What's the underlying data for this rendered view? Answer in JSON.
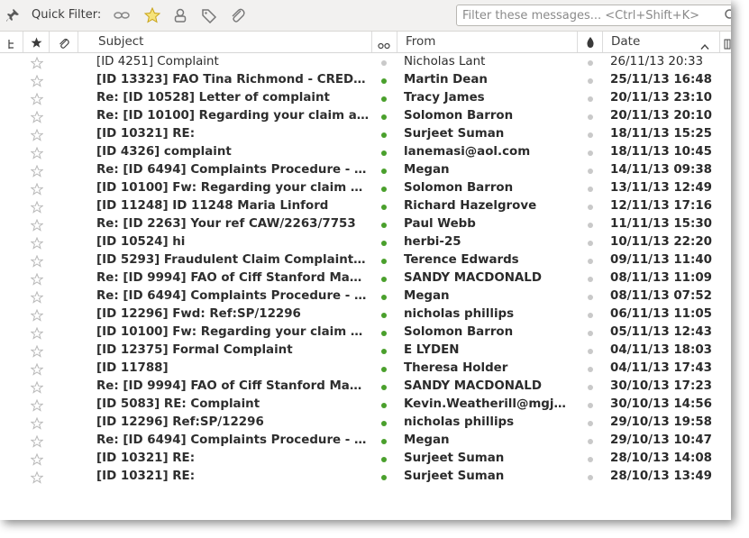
{
  "quick_filter": {
    "label": "Quick Filter:",
    "buttons": [
      "keep-filters-icon",
      "starred-icon",
      "contact-icon",
      "tags-icon",
      "attachment-icon"
    ],
    "search_placeholder": "Filter these messages... <Ctrl+Shift+K>"
  },
  "columns": {
    "thread": "thread-icon",
    "starred": "star-icon",
    "attachment": "attachment-icon",
    "subject": "Subject",
    "read": "read-status-icon",
    "from": "From",
    "junk": "junk-status-icon",
    "date": "Date",
    "sort_indicator": "sort-ascending-icon"
  },
  "colors": {
    "read_dot": "#4aa02c",
    "unread_dot": "#c9c9c9",
    "star_outline": "#b9b9b9",
    "star_filled": "#f0c419"
  },
  "messages": [
    {
      "subject": "[ID 4251] Complaint",
      "from": "Nicholas Lant",
      "date": "26/11/13 20:33",
      "unread": false
    },
    {
      "subject": "[ID 13323] FAO Tina Richmond - CREDIT ...",
      "from": "Martin Dean",
      "date": "25/11/13 16:48",
      "unread": true
    },
    {
      "subject": "Re: [ID 10528] Letter of complaint",
      "from": "Tracy James",
      "date": "20/11/13 23:10",
      "unread": true
    },
    {
      "subject": "Re: [ID 10100] Regarding your claim agai...",
      "from": "Solomon Barron",
      "date": "20/11/13 20:10",
      "unread": true
    },
    {
      "subject": "[ID 10321] RE:",
      "from": "Surjeet Suman",
      "date": "18/11/13 15:25",
      "unread": true
    },
    {
      "subject": "[ID 4326] complaint",
      "from": "lanemasi@aol.com",
      "date": "18/11/13 10:45",
      "unread": true
    },
    {
      "subject": "Re: [ID 6494] Complaints Procedure  -  C...",
      "from": "Megan",
      "date": "14/11/13 09:38",
      "unread": true
    },
    {
      "subject": "[ID 10100] Fw: Regarding your claim agai...",
      "from": "Solomon Barron",
      "date": "13/11/13 12:49",
      "unread": true
    },
    {
      "subject": "[ID 11248] ID 11248 Maria Linford",
      "from": "Richard Hazelgrove",
      "date": "12/11/13 17:16",
      "unread": true
    },
    {
      "subject": "Re: [ID 2263] Your ref CAW/2263/7753",
      "from": "Paul Webb",
      "date": "11/11/13 15:30",
      "unread": true
    },
    {
      "subject": "[ID 10524] hi",
      "from": "herbi-25",
      "date": "10/11/13 22:20",
      "unread": true
    },
    {
      "subject": "[ID 5293] Fraudulent Claim Complaint - ...",
      "from": "Terence Edwards",
      "date": "09/11/13 11:40",
      "unread": true
    },
    {
      "subject": "Re: [ID 9994] FAO of Ciff Stanford Mana...",
      "from": "SANDY MACDONALD",
      "date": "08/11/13 11:09",
      "unread": true
    },
    {
      "subject": "Re: [ID 6494] Complaints Procedure  -  C...",
      "from": "Megan",
      "date": "08/11/13 07:52",
      "unread": true
    },
    {
      "subject": "[ID 12296] Fwd: Ref:SP/12296",
      "from": "nicholas phillips",
      "date": "06/11/13 11:05",
      "unread": true
    },
    {
      "subject": "[ID 10100] Fw: Regarding your claim agai...",
      "from": "Solomon Barron",
      "date": "05/11/13 12:43",
      "unread": true
    },
    {
      "subject": "[ID 12375] Formal Complaint",
      "from": "E LYDEN",
      "date": "04/11/13 18:03",
      "unread": true
    },
    {
      "subject": "[ID 11788]",
      "from": "Theresa Holder",
      "date": "04/11/13 17:43",
      "unread": true
    },
    {
      "subject": "Re: [ID 9994] FAO of Ciff Stanford Mana...",
      "from": "SANDY MACDONALD",
      "date": "30/10/13 17:23",
      "unread": true
    },
    {
      "subject": "[ID 5083] RE: Complaint",
      "from": "Kevin.Weatherill@mgjv....",
      "date": "30/10/13 14:56",
      "unread": true
    },
    {
      "subject": "[ID 12296] Ref:SP/12296",
      "from": "nicholas phillips",
      "date": "29/10/13 19:58",
      "unread": true
    },
    {
      "subject": "Re: [ID 6494] Complaints Procedure  -  C...",
      "from": "Megan",
      "date": "29/10/13 10:47",
      "unread": true
    },
    {
      "subject": "[ID 10321] RE:",
      "from": "Surjeet Suman",
      "date": "28/10/13 14:08",
      "unread": true
    },
    {
      "subject": "[ID 10321] RE:",
      "from": "Surjeet Suman",
      "date": "28/10/13 13:49",
      "unread": true
    }
  ]
}
